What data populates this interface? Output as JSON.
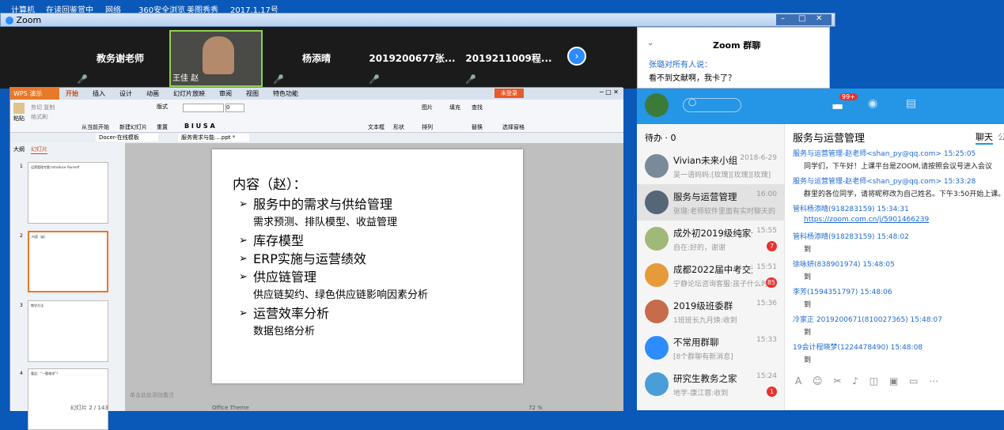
{
  "desktop": {
    "icons": [
      "计算机",
      "在读回鉴赏中",
      "网络",
      "360安全浏览",
      "美图秀秀",
      "2017.1.17号"
    ]
  },
  "zoom": {
    "title": "Zoom",
    "participants": [
      "教务谢老师",
      "王佳 赵",
      "杨添晴",
      "2019200677张...",
      "2019211009程..."
    ]
  },
  "zoom_chat": {
    "title": "Zoom 群聊",
    "from": "张璐对所有人说：",
    "text": "看不到文献啊，我卡了？"
  },
  "wps": {
    "app": "WPS 演示",
    "tabs_top": [
      "开始",
      "插入",
      "设计",
      "动画",
      "幻灯片放映",
      "审阅",
      "视图",
      "特色功能"
    ],
    "login": "未登录",
    "file_tabs": [
      "Docer-在线模板",
      "服务需求与能....ppt *"
    ],
    "ribbon": [
      "粘贴",
      "剪切",
      "复制",
      "格式刷",
      "从当前开始",
      "新建幻灯片",
      "版式",
      "重置",
      "文本框",
      "形状",
      "排列",
      "图片",
      "填充",
      "查找",
      "替换",
      "选择窗格"
    ],
    "panel_tabs": [
      "大纲",
      "幻灯片"
    ],
    "status": {
      "slides": "幻灯片 2 / 143",
      "theme": "Office Theme",
      "notes": "单击此处添加备注",
      "zoom": "72 %"
    }
  },
  "slide": {
    "heading": "内容（赵）：",
    "items": [
      {
        "b": "服务中的需求与供给管理",
        "s": "需求预测、排队模型、收益管理"
      },
      {
        "b": "库存模型",
        "s": ""
      },
      {
        "b": "ERP实施与运营绩效",
        "s": ""
      },
      {
        "b": "供应链管理",
        "s": "供应链契约、绿色供应链影响因素分析"
      },
      {
        "b": "运营效率分析",
        "s": "数据包络分析"
      }
    ]
  },
  "thumbs": [
    {
      "n": "1",
      "t": "运营管理专题 Introduce Yourself"
    },
    {
      "n": "2",
      "t": "内容（赵）"
    },
    {
      "n": "3",
      "t": "教学方法"
    },
    {
      "n": "4",
      "t": "看这：“一题难求”？"
    }
  ],
  "qq": {
    "badge": "99+",
    "todo": "待办 · 0",
    "chat_title": "服务与运营管理",
    "chat_tab": "聊天",
    "chat_tab2": "公",
    "colors": {
      "accent": "#2595e6",
      "badge": "#e8312f"
    },
    "convs": [
      {
        "name": "Vivian未来小组",
        "time": "2018-6-29",
        "preview": "吴一语妈妈:[玫瑰][玫瑰][玫瑰]",
        "badge": ""
      },
      {
        "name": "服务与运营管理",
        "time": "16:00",
        "preview": "张璐:老师软件里面有实时聊天的",
        "badge": ""
      },
      {
        "name": "成外初2019级纯家长",
        "time": "15:55",
        "preview": "自在:好的，谢谢",
        "badge": "7"
      },
      {
        "name": "成都2022届中考交流",
        "time": "15:51",
        "preview": "宁静论坛咨询客服:孩子什么时",
        "badge": "85"
      },
      {
        "name": "2019级班委群",
        "time": "15:36",
        "preview": "1班班长九月焕:收到",
        "badge": ""
      },
      {
        "name": "不常用群聊",
        "time": "15:33",
        "preview": "[8个群聊有新消息]",
        "badge": ""
      },
      {
        "name": "研究生教务之家",
        "time": "15:24",
        "preview": "地学-康江蓉:收到",
        "badge": "1"
      }
    ],
    "messages": [
      {
        "s": "服务与运营管理-赵老师<shan_py@qq.com>  15:25:05",
        "t": "同学们，下午好！上课平台是ZOOM,请按照会议号进入会议"
      },
      {
        "s": "服务与运营管理-赵老师<shan_py@qq.com>  15:33:28",
        "t": "群里的各位同学，请将昵称改为自己姓名。下午3:50开始上课。"
      },
      {
        "s": "管科杨添晴(918283159)  15:34:31",
        "t": "https://zoom.com.cn/j/5901466239"
      },
      {
        "s": "管科杨添晴(918283159)  15:48:02",
        "t": "到"
      },
      {
        "s": "徐咏妍(838901974)  15:48:05",
        "t": "到"
      },
      {
        "s": "李芳(1594351797)  15:48:06",
        "t": "到"
      },
      {
        "s": "冷家正 2019200671(810027365)  15:48:07",
        "t": "到"
      },
      {
        "s": "19会计程晓梦(1224478490)  15:48:08",
        "t": "到"
      }
    ]
  }
}
